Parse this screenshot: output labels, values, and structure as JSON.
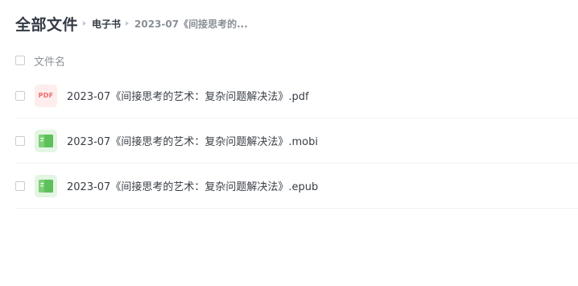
{
  "breadcrumb": {
    "root": "全部文件",
    "level1": "电子书",
    "current": "2023-07《间接思考的..."
  },
  "list_header": {
    "name_column": "文件名"
  },
  "files": [
    {
      "icon": "pdf-file-icon",
      "icon_text": "PDF",
      "name": "2023-07《间接思考的艺术：复杂问题解决法》.pdf"
    },
    {
      "icon": "ebook-file-icon",
      "name": "2023-07《间接思考的艺术：复杂问题解决法》.mobi"
    },
    {
      "icon": "ebook-file-icon",
      "name": "2023-07《间接思考的艺术：复杂问题解决法》.epub"
    }
  ],
  "colors": {
    "text_primary": "#333a44",
    "text_secondary": "#8e939a",
    "pdf_accent": "#f26b6b",
    "ebook_accent": "#5ec05a"
  }
}
